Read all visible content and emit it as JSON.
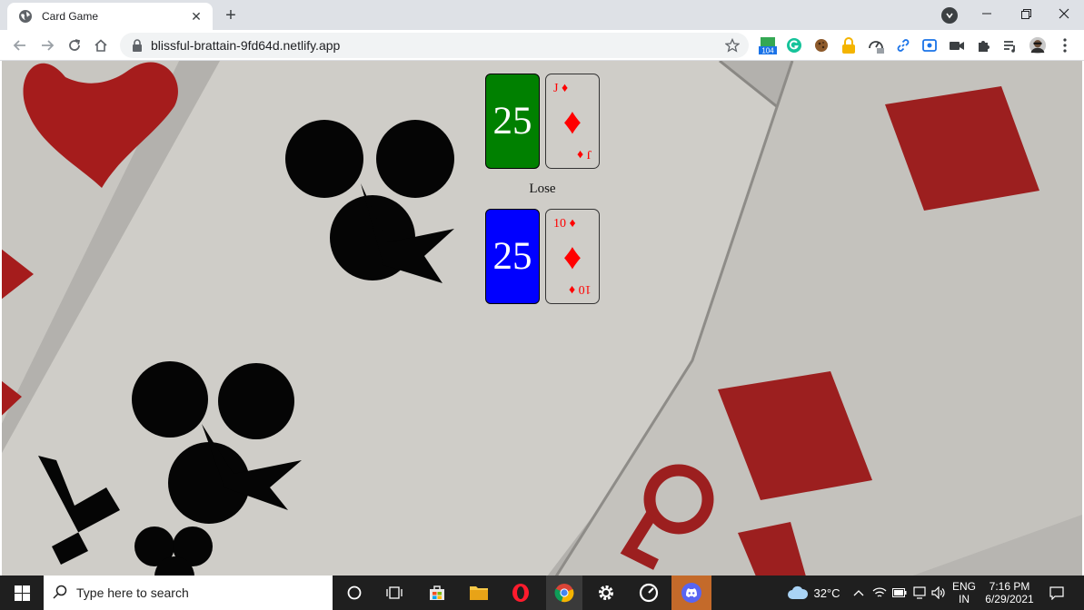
{
  "browser": {
    "tab_title": "Card Game",
    "url": "blissful-brattain-9fd64d.netlify.app",
    "extensions": [
      {
        "name": "tab-counter-icon",
        "badge": "104"
      },
      {
        "name": "grammarly-icon"
      },
      {
        "name": "cookie-icon"
      },
      {
        "name": "lock-extension-icon"
      },
      {
        "name": "speed-icon"
      },
      {
        "name": "link-icon"
      },
      {
        "name": "screen-capture-icon"
      },
      {
        "name": "video-icon"
      },
      {
        "name": "puzzle-icon"
      },
      {
        "name": "media-queue-icon"
      },
      {
        "name": "avatar"
      },
      {
        "name": "kebab-menu-icon"
      }
    ]
  },
  "game": {
    "top_deck": {
      "count": "25",
      "color": "#008000"
    },
    "top_card": {
      "corner_top": "J ♦",
      "corner_bottom": "J ♦",
      "suit": "♦"
    },
    "result": "Lose",
    "bottom_deck": {
      "count": "25",
      "color": "#0000ff"
    },
    "bottom_card": {
      "corner_top": "10 ♦",
      "corner_bottom": "10 ♦",
      "suit": "♦"
    }
  },
  "taskbar": {
    "search_placeholder": "Type here to search",
    "weather": "32°C",
    "language": "ENG",
    "region": "IN",
    "time": "7:16 PM",
    "date": "6/29/2021"
  },
  "colors": {
    "suit_red": "#ff0000",
    "taskbar_bg": "#1f1f1f"
  }
}
